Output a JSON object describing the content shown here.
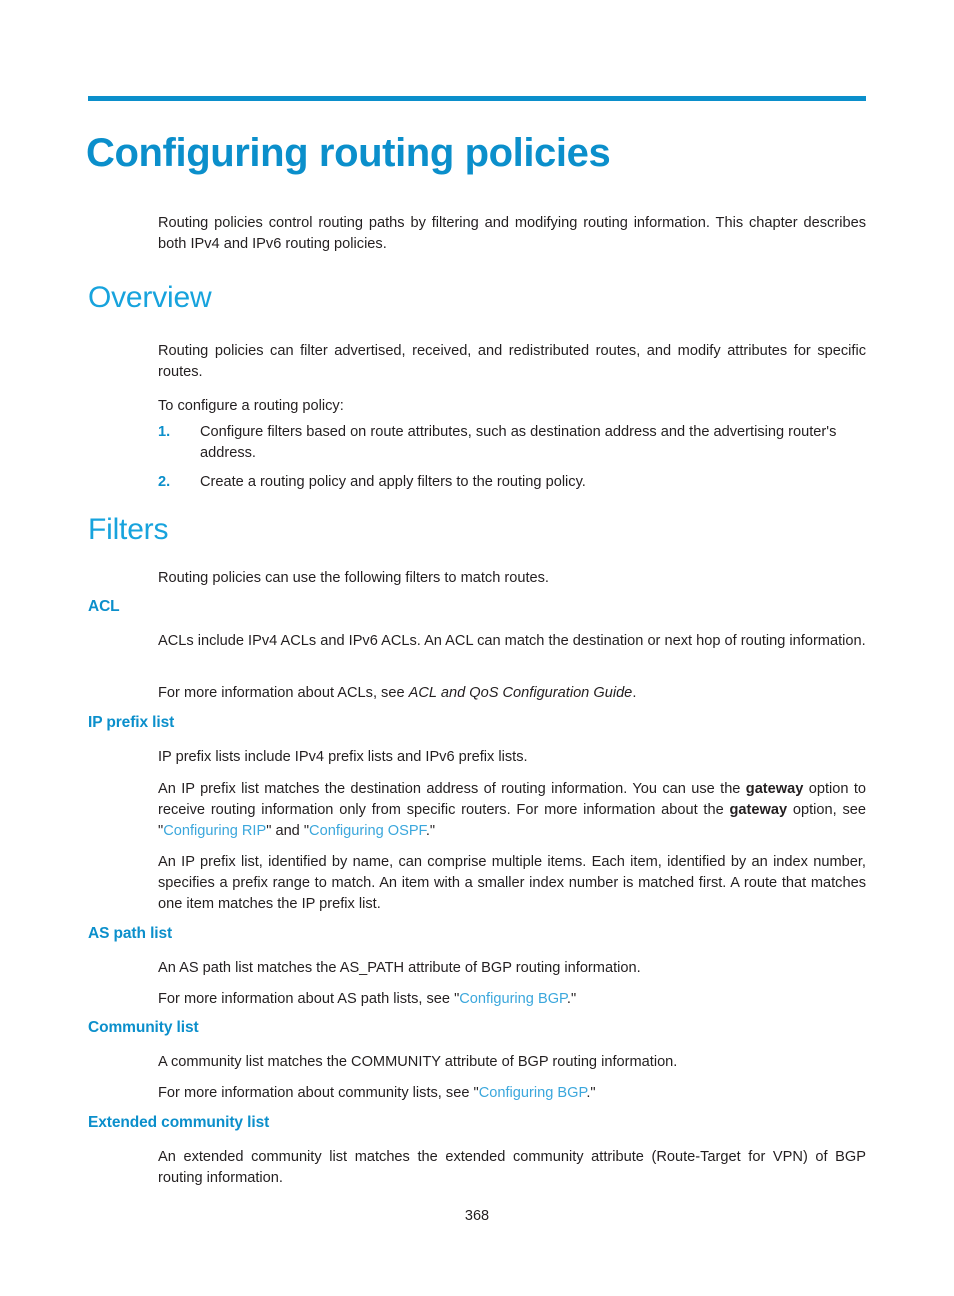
{
  "document": {
    "chapter_title": "Configuring routing policies",
    "page_number": "368"
  },
  "colors": {
    "title_blue": "#0b8fcb",
    "heading_blue": "#17a3dd",
    "subheading_blue": "#0b8fcb",
    "link_blue": "#3ba7dc",
    "body_text": "#231f20",
    "rule": "#0b8fcb"
  },
  "intro": {
    "text": "Routing policies control routing paths by filtering and modifying routing information. This chapter describes both IPv4 and IPv6 routing policies."
  },
  "sections": {
    "overview": {
      "heading": "Overview",
      "paragraph_1": "Routing policies can filter advertised, received, and redistributed routes, and modify attributes for specific routes.",
      "paragraph_2": "To configure a routing policy:",
      "steps": [
        {
          "number": "1.",
          "text": "Configure filters based on route attributes, such as destination address and the advertising router's address."
        },
        {
          "number": "2.",
          "text": "Create a routing policy and apply filters to the routing policy."
        }
      ]
    },
    "filters": {
      "heading": "Filters",
      "paragraph_1": "Routing policies can use the following filters to match routes.",
      "acl": {
        "heading": "ACL",
        "paragraph_1": "ACLs include IPv4 ACLs and IPv6 ACLs. An ACL can match the destination or next hop of routing information.",
        "paragraph_2_prefix": "For more information about ACLs, see ",
        "paragraph_2_italic": "ACL and QoS Configuration Guide",
        "paragraph_2_suffix": "."
      },
      "ip_prefix_list": {
        "heading": "IP prefix list",
        "paragraph_1": "IP prefix lists include IPv4 prefix lists and IPv6 prefix lists.",
        "paragraph_2_part1": "An IP prefix list matches the destination address of routing information. You can use the ",
        "paragraph_2_bold1": "gateway",
        "paragraph_2_part2": " option to receive routing information only from specific routers. For more information about the ",
        "paragraph_2_bold2": "gateway",
        "paragraph_2_part3": " option, see \"",
        "paragraph_2_link1": "Configuring RIP",
        "paragraph_2_part4": "\" and \"",
        "paragraph_2_link2": "Configuring OSPF",
        "paragraph_2_part5": ".\"",
        "paragraph_3": "An IP prefix list, identified by name, can comprise multiple items. Each item, identified by an index number, specifies a prefix range to match. An item with a smaller index number is matched first. A route that matches one item matches the IP prefix list."
      },
      "as_path_list": {
        "heading": "AS path list",
        "paragraph_1": "An AS path list matches the AS_PATH attribute of BGP routing information.",
        "paragraph_2_prefix": "For more information about AS path lists, see \"",
        "paragraph_2_link": "Configuring BGP",
        "paragraph_2_suffix": ".\""
      },
      "community_list": {
        "heading": "Community list",
        "paragraph_1": "A community list matches the COMMUNITY attribute of BGP routing information.",
        "paragraph_2_prefix": "For more information about community lists, see \"",
        "paragraph_2_link": "Configuring BGP",
        "paragraph_2_suffix": ".\""
      },
      "extended_community_list": {
        "heading": "Extended community list",
        "paragraph_1": "An extended community list matches the extended community attribute (Route-Target for VPN) of BGP routing information."
      }
    }
  }
}
